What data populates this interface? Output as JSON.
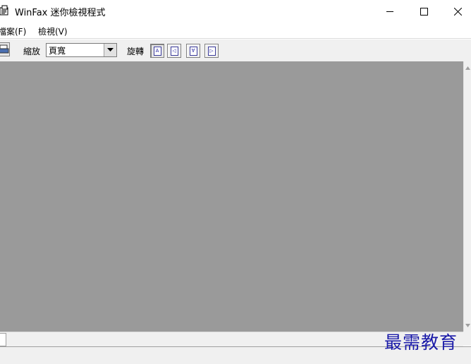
{
  "window": {
    "title": "WinFax 迷你檢視程式"
  },
  "menu": {
    "items": [
      {
        "label": "檔案(F)"
      },
      {
        "label": "檢視(V)"
      }
    ]
  },
  "toolbar": {
    "zoom_label": "縮放",
    "zoom_value": "頁寬",
    "rotate_label": "旋轉",
    "rotate_buttons": [
      {
        "glyph": "A",
        "icon": "rotate-0-icon"
      },
      {
        "glyph": "◁",
        "icon": "rotate-left-icon"
      },
      {
        "glyph": "∀",
        "icon": "rotate-180-icon"
      },
      {
        "glyph": "▷",
        "icon": "rotate-right-icon"
      }
    ]
  },
  "watermark": {
    "text": "最需教育"
  },
  "colors": {
    "viewer_background": "#9a9a9a",
    "watermark": "#1a1aa8"
  }
}
